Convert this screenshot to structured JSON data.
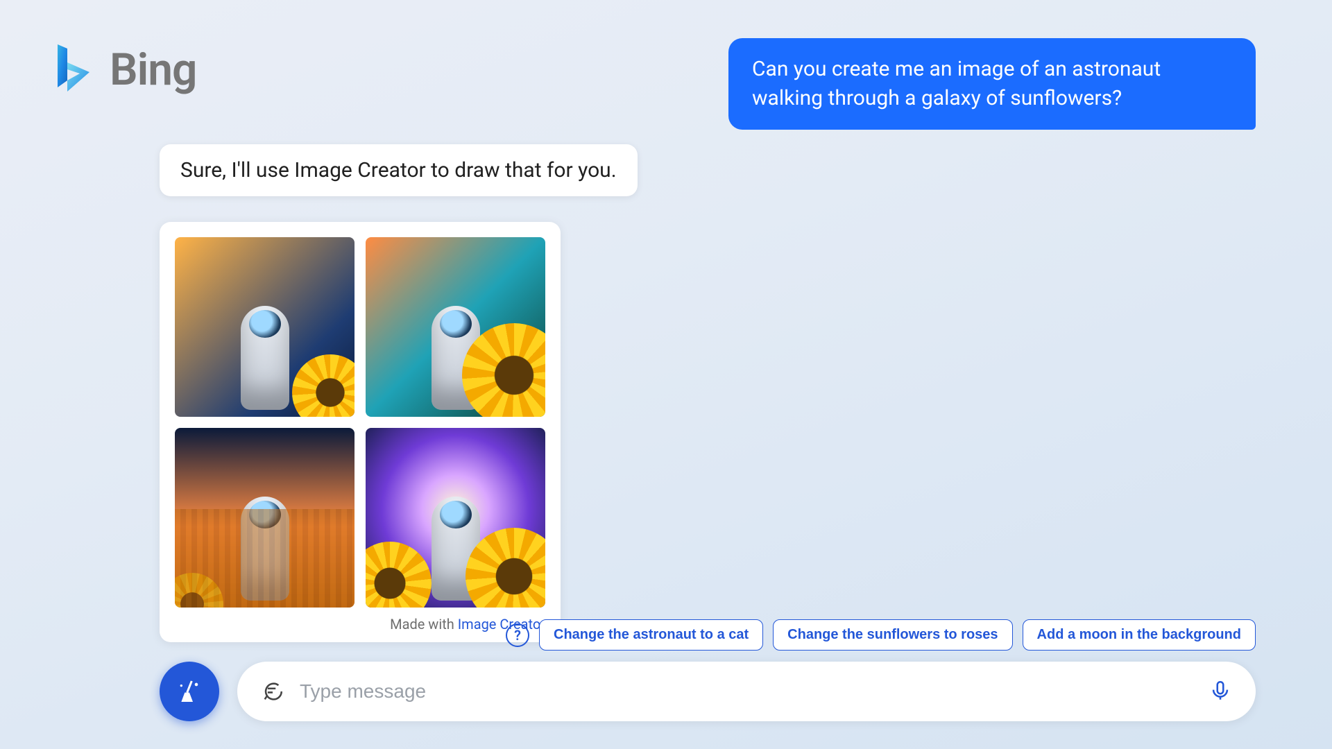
{
  "brand": {
    "name": "Bing"
  },
  "chat": {
    "user_message": "Can you create me an image of an astronaut walking through a galaxy of sunflowers?",
    "bot_message": "Sure, I'll use Image Creator to draw that for you.",
    "image_card": {
      "footer_prefix": "Made with ",
      "footer_link": "Image Creator",
      "images": [
        {
          "alt": "Astronaut with planet and sunflowers"
        },
        {
          "alt": "Astronaut walking among sunflowers under nebula sky"
        },
        {
          "alt": "Astronaut in sunflower field at dusk"
        },
        {
          "alt": "Astronaut before swirling portal with sunflowers"
        }
      ]
    }
  },
  "suggestions": [
    "Change the astronaut to a cat",
    "Change the sunflowers to roses",
    "Add a moon in the background"
  ],
  "composer": {
    "placeholder": "Type message"
  }
}
